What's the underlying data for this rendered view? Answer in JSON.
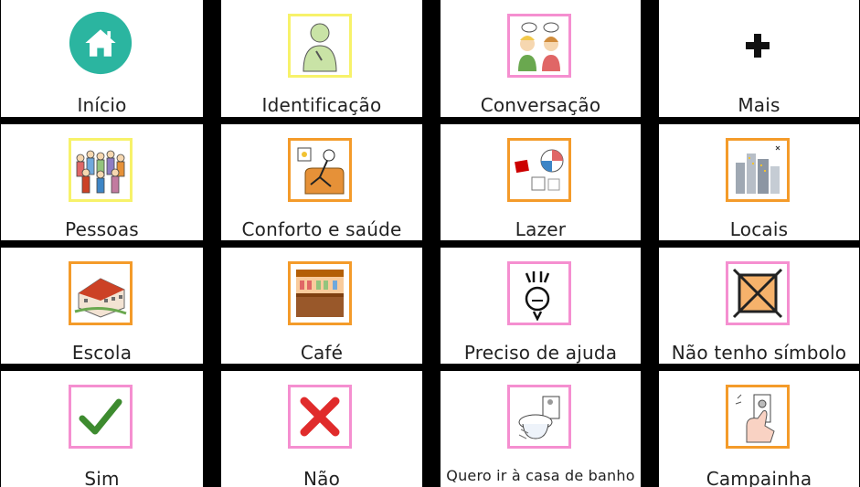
{
  "tiles": [
    {
      "label": "Início",
      "icon": "home-icon"
    },
    {
      "label": "Identificação",
      "icon": "person-icon"
    },
    {
      "label": "Conversação",
      "icon": "conversation-icon"
    },
    {
      "label": "Mais",
      "icon": "plus-icon"
    },
    {
      "label": "Pessoas",
      "icon": "people-icon"
    },
    {
      "label": "Conforto e saúde",
      "icon": "armchair-person-icon"
    },
    {
      "label": "Lazer",
      "icon": "leisure-icon"
    },
    {
      "label": "Locais",
      "icon": "city-icon"
    },
    {
      "label": "Escola",
      "icon": "school-icon"
    },
    {
      "label": "Café",
      "icon": "cafe-icon"
    },
    {
      "label": "Preciso de ajuda",
      "icon": "help-hands-icon"
    },
    {
      "label": "Não tenho símbolo",
      "icon": "no-symbol-icon"
    },
    {
      "label": "Sim",
      "icon": "checkmark-icon"
    },
    {
      "label": "Não",
      "icon": "cross-icon"
    },
    {
      "label": "Quero ir à casa de banho",
      "icon": "toilet-icon"
    },
    {
      "label": "Campainha",
      "icon": "doorbell-icon"
    }
  ],
  "colors": {
    "home_teal": "#2bb5a0",
    "border_yellow": "#f7f26a",
    "border_orange": "#f49b2a",
    "border_pink": "#f58fd0",
    "check_green": "#3d8b2f",
    "cross_red": "#e02b2b"
  }
}
